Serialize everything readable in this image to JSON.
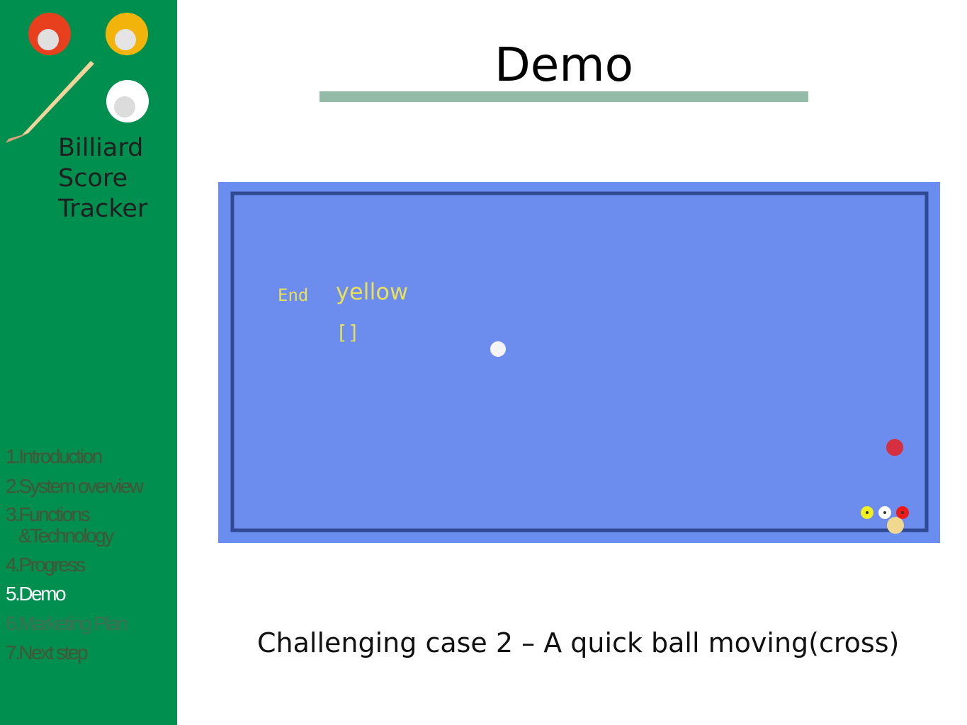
{
  "sidebar": {
    "brand_lines": [
      "Billiard",
      "Score",
      "Tracker"
    ],
    "logo_icons": [
      "red-ball-icon",
      "yellow-ball-icon",
      "white-ball-icon",
      "cue-stick-icon"
    ],
    "nav": [
      {
        "label": "1.Introduction"
      },
      {
        "label": "2.System overview"
      },
      {
        "label_line1": "3.Functions",
        "label_line2": "&Technology"
      },
      {
        "label": "4.Progress"
      },
      {
        "label": "5.Demo",
        "active": true
      },
      {
        "label": "6.Marketing Plan"
      },
      {
        "label": "7.Next step"
      }
    ]
  },
  "slide": {
    "title": "Demo",
    "caption": "Challenging case 2 – A quick ball moving(cross)"
  },
  "video": {
    "overlay_status": "End",
    "overlay_ball": "yellow",
    "overlay_brackets": "[]",
    "colors": {
      "table": "#6a8df0",
      "overlay_text": "#e8e05a"
    }
  }
}
